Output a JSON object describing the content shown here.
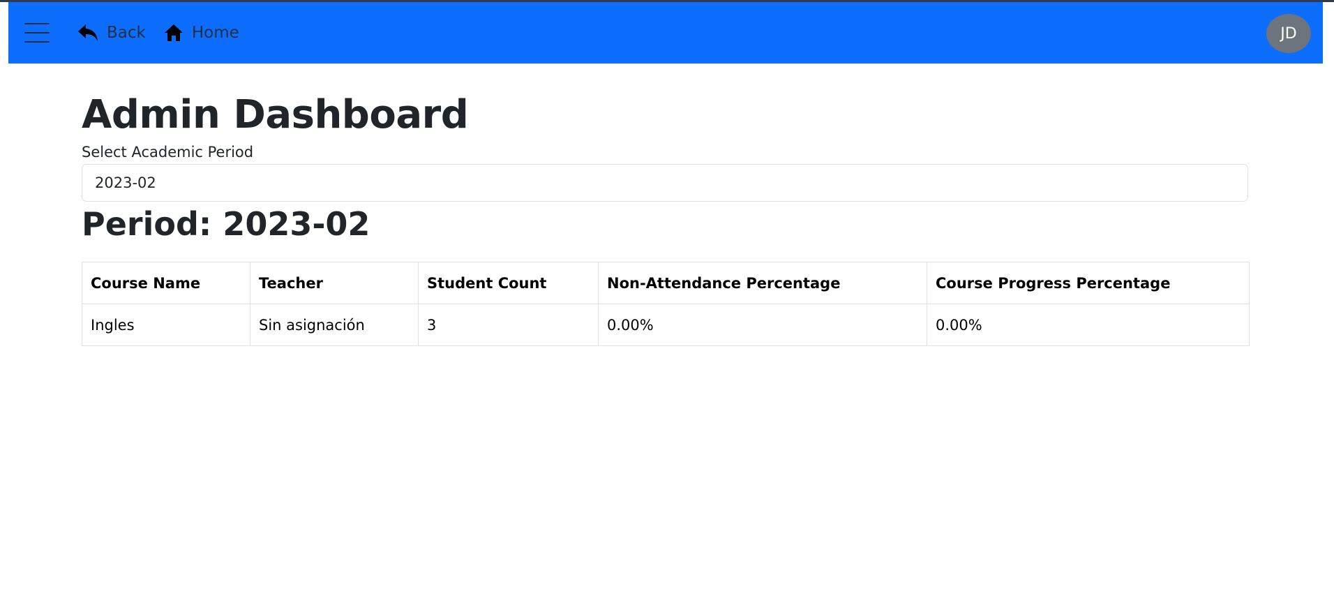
{
  "navbar": {
    "menu_icon": "hamburger-menu-icon",
    "back_label": "Back",
    "back_icon": "reply-arrow-icon",
    "home_label": "Home",
    "home_icon": "house-icon",
    "avatar_initials": "JD",
    "background_color": "#0d6efd"
  },
  "main": {
    "title": "Admin Dashboard",
    "period_select": {
      "label": "Select Academic Period",
      "value": "2023-02"
    },
    "period_heading": "Period: 2023-02",
    "table": {
      "columns": [
        "Course Name",
        "Teacher",
        "Student Count",
        "Non-Attendance Percentage",
        "Course Progress Percentage"
      ],
      "rows": [
        [
          "Ingles",
          "Sin asignación",
          "3",
          "0.00%",
          "0.00%"
        ]
      ]
    }
  }
}
